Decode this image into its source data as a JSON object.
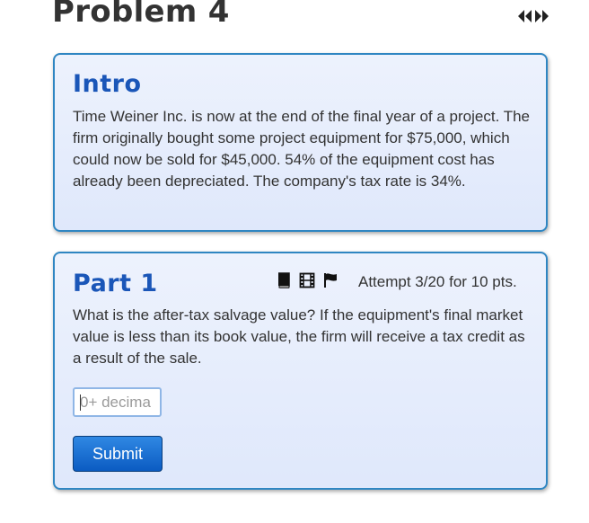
{
  "problem": {
    "title": "Problem 4"
  },
  "intro": {
    "heading": "Intro",
    "text": "Time Weiner Inc. is now at the end of the final year of a project. The firm originally bought some project equipment for $75,000, which could now be sold for $45,000. 54% of the equipment cost has already been depreciated. The company's tax rate is 34%."
  },
  "part1": {
    "heading": "Part 1",
    "attempt": "Attempt 3/20 for 10 pts.",
    "question": "What is the after-tax salvage value? If the equipment's final market value is less than its book value, the firm will receive a tax credit as a result of the sale.",
    "input": {
      "value": "",
      "placeholder": "0+ decima"
    },
    "submit_label": "Submit",
    "tool_icons": [
      "book-icon",
      "film-icon",
      "flag-icon"
    ]
  },
  "nav": {
    "icons": [
      "previous-arrow-icon",
      "next-arrow-icon"
    ]
  },
  "colors": {
    "heading": "#1a56b8",
    "card_border": "#2f86c2",
    "card_background": "#e6edfc",
    "button": "#0b5bc2",
    "text": "#333333"
  }
}
